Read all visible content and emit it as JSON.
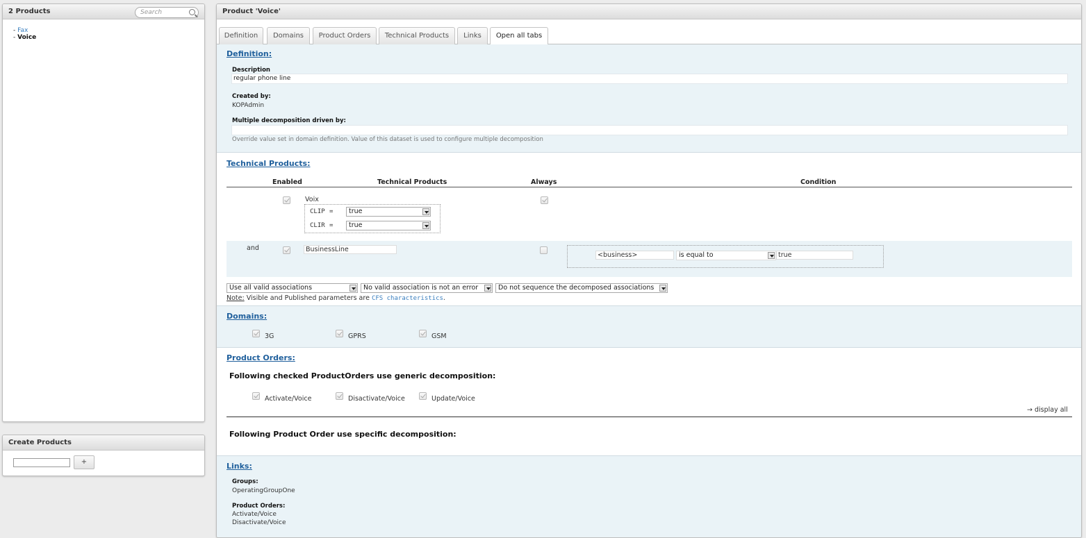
{
  "products_panel": {
    "title": "2 Products",
    "search_placeholder": "Search",
    "items": [
      {
        "label": "Fax"
      },
      {
        "label": "Voice"
      }
    ]
  },
  "create_panel": {
    "title": "Create Products",
    "add_label": "+"
  },
  "main": {
    "title": "Product 'Voice'",
    "tabs": [
      {
        "label": "Definition"
      },
      {
        "label": "Domains"
      },
      {
        "label": "Product Orders"
      },
      {
        "label": "Technical Products"
      },
      {
        "label": "Links"
      },
      {
        "label": "Open all tabs"
      }
    ],
    "definition": {
      "title": "Definition:",
      "description_label": "Description",
      "description_value": "regular phone line",
      "created_by_label": "Created by:",
      "created_by_value": "KOPAdmin",
      "multi_decomp_label": "Multiple decomposition driven by:",
      "multi_decomp_value": "",
      "multi_decomp_hint": "Override value set in domain definition. Value of this dataset is used to configure multiple decomposition"
    },
    "technical_products": {
      "title": "Technical Products:",
      "headers": {
        "enabled": "Enabled",
        "technical_products": "Technical Products",
        "always": "Always",
        "condition": "Condition"
      },
      "rows": [
        {
          "prefix": "",
          "name": "Voix",
          "params": [
            {
              "name": "CLIP",
              "op": "=",
              "value": "true"
            },
            {
              "name": "CLIR",
              "op": "=",
              "value": "true"
            }
          ]
        },
        {
          "prefix": "and",
          "name": "BusinessLine",
          "condition": {
            "field": "<business>",
            "operator": "is equal to",
            "value": "true"
          }
        }
      ],
      "select_assoc": "Use all valid associations",
      "select_error": "No valid association is not an error",
      "select_sequence": "Do not sequence the decomposed associations",
      "note_label": "Note:",
      "note_text": "Visible and Published parameters are",
      "note_link": "CFS characteristics",
      "note_end": "."
    },
    "domains": {
      "title": "Domains:",
      "items": [
        {
          "label": "3G"
        },
        {
          "label": "GPRS"
        },
        {
          "label": "GSM"
        }
      ]
    },
    "product_orders": {
      "title": "Product Orders:",
      "generic_heading": "Following checked ProductOrders use generic decomposition:",
      "items": [
        {
          "label": "Activate/Voice"
        },
        {
          "label": "Disactivate/Voice"
        },
        {
          "label": "Update/Voice"
        }
      ],
      "display_all": "→ display all",
      "specific_heading": "Following Product Order use specific decomposition:"
    },
    "links": {
      "title": "Links:",
      "groups_label": "Groups:",
      "groups_value": "OperatingGroupOne",
      "orders_label": "Product Orders:",
      "orders_values": [
        "Activate/Voice",
        "Disactivate/Voice"
      ]
    }
  }
}
